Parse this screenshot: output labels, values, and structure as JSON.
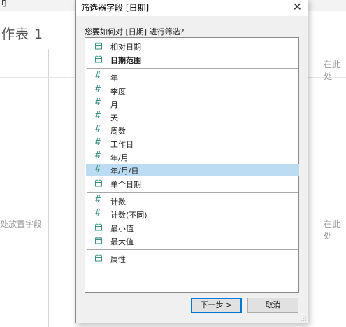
{
  "background": {
    "top_fragment": "ŋ",
    "sheet_title": "作表 1",
    "drop_left": "处放置字段",
    "drop_right_top": "在此处",
    "drop_right_mid": "在此处"
  },
  "dialog": {
    "title": "筛选器字段 [日期]",
    "prompt": "您要如何对 [日期] 进行筛选?",
    "groups": [
      [
        {
          "label": "相对日期",
          "icon": "calendar-icon",
          "bold": false,
          "selected": false
        },
        {
          "label": "日期范围",
          "icon": "calendar-icon",
          "bold": true,
          "selected": false
        }
      ],
      [
        {
          "label": "年",
          "icon": "hash-icon",
          "bold": false,
          "selected": false
        },
        {
          "label": "季度",
          "icon": "hash-icon",
          "bold": false,
          "selected": false
        },
        {
          "label": "月",
          "icon": "hash-icon",
          "bold": false,
          "selected": false
        },
        {
          "label": "天",
          "icon": "hash-icon",
          "bold": false,
          "selected": false
        },
        {
          "label": "周数",
          "icon": "hash-icon",
          "bold": false,
          "selected": false
        },
        {
          "label": "工作日",
          "icon": "hash-icon",
          "bold": false,
          "selected": false
        },
        {
          "label": "年/月",
          "icon": "hash-icon",
          "bold": false,
          "selected": false
        },
        {
          "label": "年/月/日",
          "icon": "hash-icon",
          "bold": false,
          "selected": true
        },
        {
          "label": "单个日期",
          "icon": "calendar-icon",
          "bold": false,
          "selected": false
        }
      ],
      [
        {
          "label": "计数",
          "icon": "hash-icon",
          "bold": false,
          "selected": false
        },
        {
          "label": "计数(不同)",
          "icon": "hash-icon",
          "bold": false,
          "selected": false
        },
        {
          "label": "最小值",
          "icon": "calendar-icon",
          "bold": false,
          "selected": false
        },
        {
          "label": "最大值",
          "icon": "calendar-icon",
          "bold": false,
          "selected": false
        }
      ],
      [
        {
          "label": "属性",
          "icon": "calendar-icon",
          "bold": false,
          "selected": false
        }
      ]
    ],
    "next_label": "下一步 >",
    "cancel_label": "取消"
  },
  "colors": {
    "accent": "#0078d7",
    "selection": "#bcdcf4",
    "icon": "#3e8e83"
  }
}
